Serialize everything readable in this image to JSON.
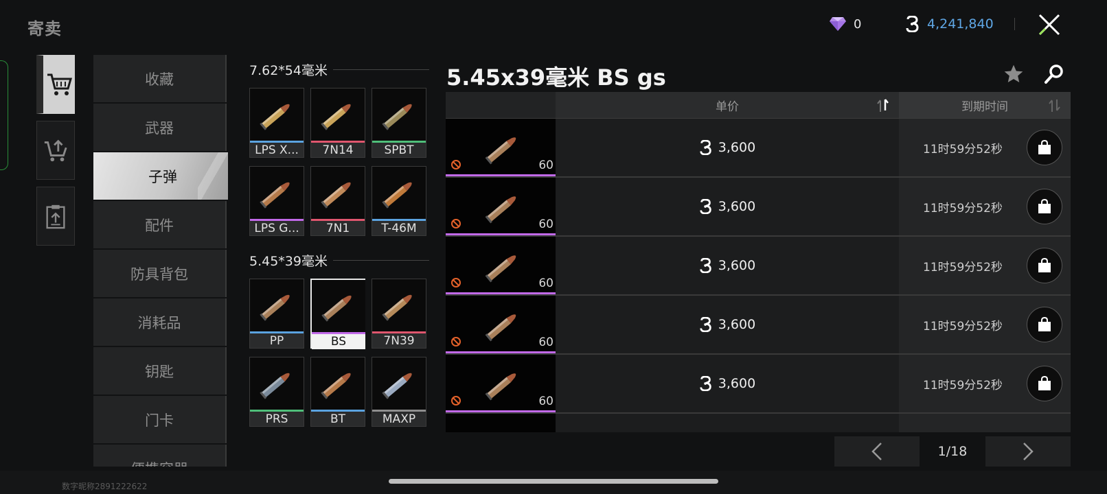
{
  "header": {
    "title": "寄卖",
    "gems": "0",
    "money": "4,241,840"
  },
  "side_nav": [
    {
      "name": "buy-cart",
      "icon": "cart-icon",
      "active": true
    },
    {
      "name": "sell-cart",
      "icon": "cart-upload-icon",
      "active": false
    },
    {
      "name": "orders",
      "icon": "clipboard-upload-icon",
      "active": false
    }
  ],
  "categories": [
    {
      "label": "收藏",
      "active": false
    },
    {
      "label": "武器",
      "active": false
    },
    {
      "label": "子弹",
      "active": true
    },
    {
      "label": "配件",
      "active": false
    },
    {
      "label": "防具背包",
      "active": false
    },
    {
      "label": "消耗品",
      "active": false
    },
    {
      "label": "钥匙",
      "active": false
    },
    {
      "label": "门卡",
      "active": false
    },
    {
      "label": "便携容器",
      "active": false
    }
  ],
  "ammo_groups": [
    {
      "title": "7.62*54毫米",
      "items": [
        {
          "label": "LPS X...",
          "rarity": "#5ba3e0",
          "tint": "#c9a45a",
          "selected": false
        },
        {
          "label": "7N14",
          "rarity": "#e0566e",
          "tint": "#c9a45a",
          "selected": false
        },
        {
          "label": "SPBT",
          "rarity": "#4fbf7a",
          "tint": "#9a8a5a",
          "selected": false
        },
        {
          "label": "LPS G...",
          "rarity": "#c169e8",
          "tint": "#b57a4a",
          "selected": false
        },
        {
          "label": "7N1",
          "rarity": "#e0566e",
          "tint": "#c08a5a",
          "selected": false
        },
        {
          "label": "T-46M",
          "rarity": "#5ba3e0",
          "tint": "#c07a3a",
          "selected": false
        }
      ]
    },
    {
      "title": "5.45*39毫米",
      "items": [
        {
          "label": "PP",
          "rarity": "#5ba3e0",
          "tint": "#a9805a",
          "selected": false
        },
        {
          "label": "BS",
          "rarity": "#c169e8",
          "tint": "#a9805a",
          "selected": true
        },
        {
          "label": "7N39",
          "rarity": "#e0566e",
          "tint": "#b58a5a",
          "selected": false
        },
        {
          "label": "PRS",
          "rarity": "#4fbf7a",
          "tint": "#7a8a9a",
          "selected": false
        },
        {
          "label": "BT",
          "rarity": "#5ba3e0",
          "tint": "#b57a4a",
          "selected": false
        },
        {
          "label": "MAXP",
          "rarity": "#8e8e8e",
          "tint": "#9aaac0",
          "selected": false
        }
      ]
    }
  ],
  "listing": {
    "title": "5.45x39毫米 BS gs",
    "col_price": "单价",
    "col_expiry": "到期时间",
    "rows": [
      {
        "qty": "60",
        "price": "3,600",
        "expiry": "11时59分52秒"
      },
      {
        "qty": "60",
        "price": "3,600",
        "expiry": "11时59分52秒"
      },
      {
        "qty": "60",
        "price": "3,600",
        "expiry": "11时59分52秒"
      },
      {
        "qty": "60",
        "price": "3,600",
        "expiry": "11时59分52秒"
      },
      {
        "qty": "60",
        "price": "3,600",
        "expiry": "11时59分52秒"
      }
    ]
  },
  "pager": {
    "page": "1/18"
  },
  "footer": {
    "user_id": "数字昵称2891222622"
  },
  "colors": {
    "money": "#5fa7e6",
    "rarity_purple": "#c169e8",
    "rarity_blue": "#5ba3e0",
    "rarity_red": "#e0566e",
    "rarity_green": "#4fbf7a"
  }
}
